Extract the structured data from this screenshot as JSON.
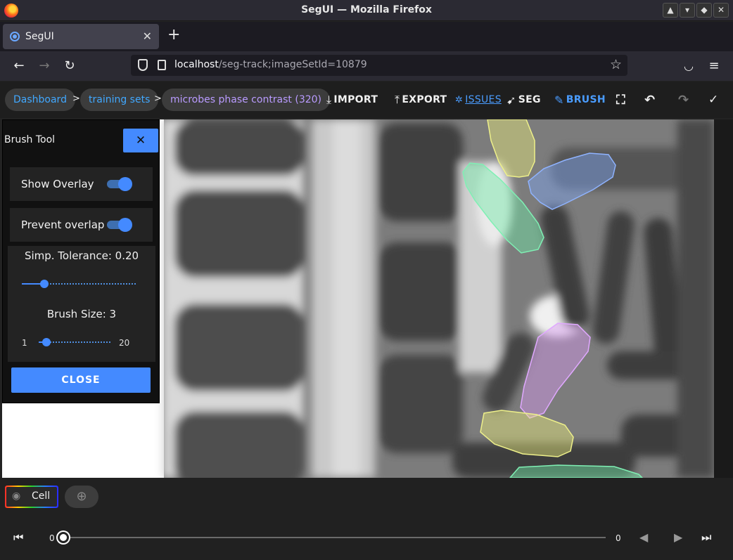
{
  "window": {
    "title": "SegUI — Mozilla Firefox"
  },
  "tab": {
    "label": "SegUI"
  },
  "urlbar": {
    "host": "localhost",
    "path": "/seg-track;imageSetId=10879"
  },
  "breadcrumbs": [
    {
      "label": "Dashboard"
    },
    {
      "label": "training sets"
    },
    {
      "label": "microbes phase contrast (320)"
    }
  ],
  "breadcrumb_separator": ">",
  "toolbar": {
    "import_label": "IMPORT",
    "export_label": "EXPORT",
    "issues_label": "ISSUES",
    "seg_label": "SEG",
    "brush_label": "BRUSH"
  },
  "brush_panel": {
    "title": "Brush Tool",
    "show_overlay_label": "Show Overlay",
    "show_overlay_on": true,
    "prevent_overlap_label": "Prevent overlap",
    "prevent_overlap_on": true,
    "tolerance_label": "Simp. Tolerance: 0.20",
    "tolerance_value": 0.2,
    "brush_size_label": "Brush Size: 3",
    "brush_size_value": 3,
    "brush_min": "1",
    "brush_max": "20",
    "close_label": "CLOSE"
  },
  "layers": [
    {
      "label": "Cell"
    }
  ],
  "player": {
    "frame_start": "0",
    "frame_end": "0",
    "position_fraction": 0
  },
  "colors": {
    "accent": "#448aff",
    "breadcrumb_link": "#41a8ff",
    "breadcrumb_current": "#b99bff",
    "overlay_yellow": "#e8eb7a",
    "overlay_green": "#6ee8a6",
    "overlay_blue": "#7ea6f5",
    "overlay_purple": "#d79af0"
  }
}
